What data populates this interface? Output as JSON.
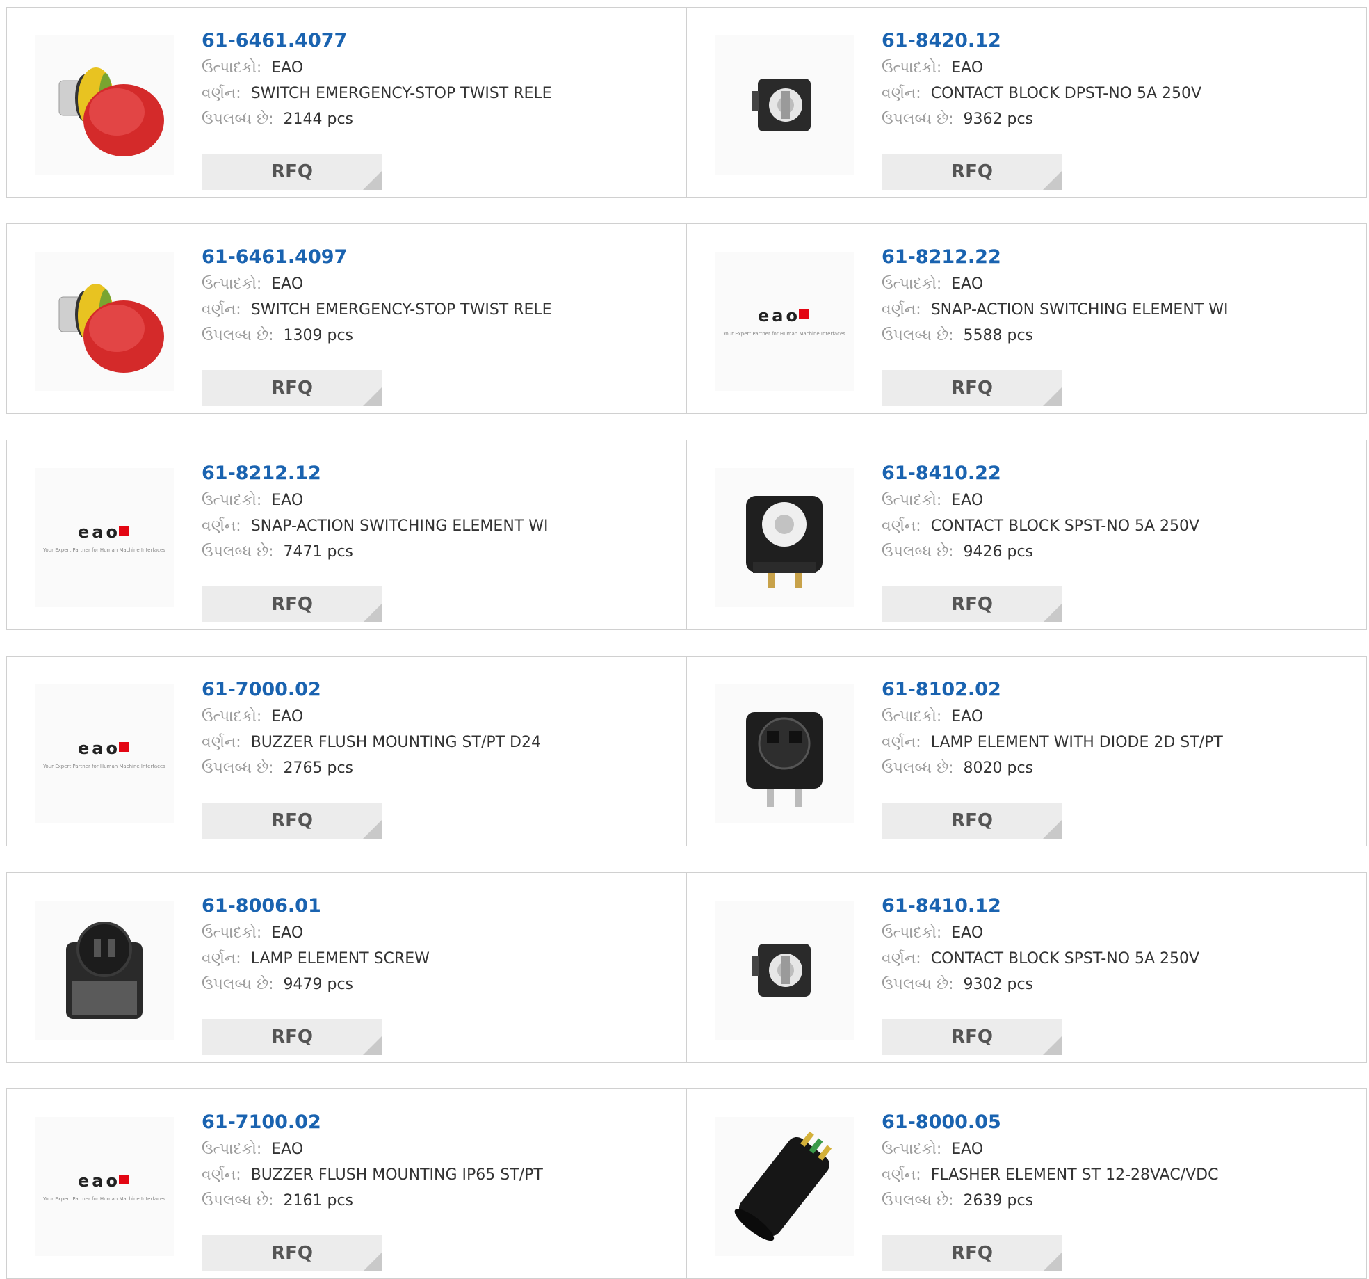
{
  "labels": {
    "manufacturer": "ઉત્પાદકો:",
    "description": "વર્ણન:",
    "available": "ઉપલબ્ધ છે:",
    "rfq": "RFQ",
    "eao_logo_word": "eao",
    "eao_tagline": "Your Expert Partner for Human Machine Interfaces"
  },
  "products": [
    {
      "part": "61-6461.4077",
      "manufacturer": "EAO",
      "description": "SWITCH EMERGENCY-STOP TWIST RELE",
      "stock": "2144 pcs",
      "image": "estop-red"
    },
    {
      "part": "61-8420.12",
      "manufacturer": "EAO",
      "description": "CONTACT BLOCK DPST-NO 5A 250V",
      "stock": "9362 pcs",
      "image": "contact-block-small"
    },
    {
      "part": "61-6461.4097",
      "manufacturer": "EAO",
      "description": "SWITCH EMERGENCY-STOP TWIST RELE",
      "stock": "1309 pcs",
      "image": "estop-red"
    },
    {
      "part": "61-8212.22",
      "manufacturer": "EAO",
      "description": "SNAP-ACTION SWITCHING ELEMENT WI",
      "stock": "5588 pcs",
      "image": "eao-logo"
    },
    {
      "part": "61-8212.12",
      "manufacturer": "EAO",
      "description": "SNAP-ACTION SWITCHING ELEMENT WI",
      "stock": "7471 pcs",
      "image": "eao-logo"
    },
    {
      "part": "61-8410.22",
      "manufacturer": "EAO",
      "description": "CONTACT BLOCK SPST-NO 5A 250V",
      "stock": "9426 pcs",
      "image": "contact-block-large"
    },
    {
      "part": "61-7000.02",
      "manufacturer": "EAO",
      "description": "BUZZER FLUSH MOUNTING ST/PT D24",
      "stock": "2765 pcs",
      "image": "eao-logo"
    },
    {
      "part": "61-8102.02",
      "manufacturer": "EAO",
      "description": "LAMP ELEMENT WITH DIODE 2D ST/PT",
      "stock": "8020 pcs",
      "image": "lamp-element-diode"
    },
    {
      "part": "61-8006.01",
      "manufacturer": "EAO",
      "description": "LAMP ELEMENT SCREW",
      "stock": "9479 pcs",
      "image": "lamp-element-screw"
    },
    {
      "part": "61-8410.12",
      "manufacturer": "EAO",
      "description": "CONTACT BLOCK SPST-NO 5A 250V",
      "stock": "9302 pcs",
      "image": "contact-block-small"
    },
    {
      "part": "61-7100.02",
      "manufacturer": "EAO",
      "description": "BUZZER FLUSH MOUNTING IP65 ST/PT",
      "stock": "2161 pcs",
      "image": "eao-logo"
    },
    {
      "part": "61-8000.05",
      "manufacturer": "EAO",
      "description": "FLASHER ELEMENT ST 12-28VAC/VDC",
      "stock": "2639 pcs",
      "image": "flasher-cylinder"
    }
  ],
  "colors": {
    "part_link": "#1a63b0",
    "label_gray": "#9a9a9a",
    "button_bg": "#ececec",
    "eao_red": "#e30613",
    "estop_red": "#d42a2a",
    "estop_yellow": "#e8c321"
  }
}
